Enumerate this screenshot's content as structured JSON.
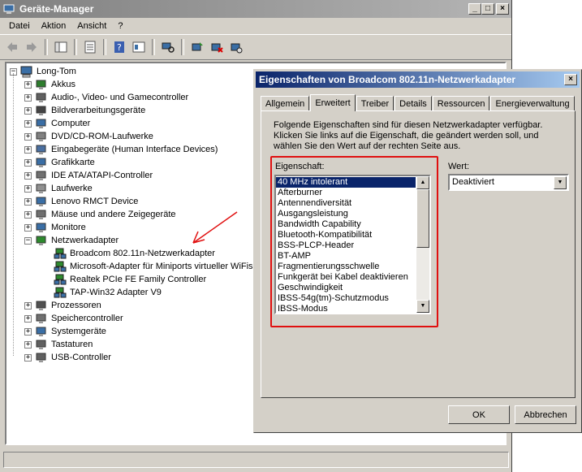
{
  "main_window": {
    "title": "Geräte-Manager",
    "controls": {
      "minimize": "_",
      "maximize": "□",
      "close": "×"
    },
    "menu": [
      "Datei",
      "Aktion",
      "Ansicht",
      "?"
    ]
  },
  "tree": {
    "root": "Long-Tom",
    "categories": [
      {
        "label": "Akkus",
        "icon": "battery-icon",
        "color": "#2d7d2d"
      },
      {
        "label": "Audio-, Video- und Gamecontroller",
        "icon": "speaker-icon",
        "color": "#606060"
      },
      {
        "label": "Bildverarbeitungsgeräte",
        "icon": "camera-icon",
        "color": "#444444"
      },
      {
        "label": "Computer",
        "icon": "computer-icon",
        "color": "#3a6ea5"
      },
      {
        "label": "DVD/CD-ROM-Laufwerke",
        "icon": "cdrom-icon",
        "color": "#808080"
      },
      {
        "label": "Eingabegeräte (Human Interface Devices)",
        "icon": "hid-icon",
        "color": "#4a6fa0"
      },
      {
        "label": "Grafikkarte",
        "icon": "display-adapter-icon",
        "color": "#3a6ea5"
      },
      {
        "label": "IDE ATA/ATAPI-Controller",
        "icon": "ide-icon",
        "color": "#707070"
      },
      {
        "label": "Laufwerke",
        "icon": "disk-drive-icon",
        "color": "#909090"
      },
      {
        "label": "Lenovo RMCT Device",
        "icon": "device-icon",
        "color": "#3a6ea5"
      },
      {
        "label": "Mäuse und andere Zeigegeräte",
        "icon": "mouse-icon",
        "color": "#707070"
      },
      {
        "label": "Monitore",
        "icon": "monitor-icon",
        "color": "#3a6ea5"
      },
      {
        "label": "Netzwerkadapter",
        "icon": "network-icon",
        "color": "#2d8a2d",
        "expanded": true,
        "children": [
          "Broadcom 802.11n-Netzwerkadapter",
          "Microsoft-Adapter für Miniports virtueller WiFis",
          "Realtek PCIe FE Family Controller",
          "TAP-Win32 Adapter V9"
        ]
      },
      {
        "label": "Prozessoren",
        "icon": "processor-icon",
        "color": "#505050"
      },
      {
        "label": "Speichercontroller",
        "icon": "storage-controller-icon",
        "color": "#707070"
      },
      {
        "label": "Systemgeräte",
        "icon": "system-device-icon",
        "color": "#3a6ea5"
      },
      {
        "label": "Tastaturen",
        "icon": "keyboard-icon",
        "color": "#606060"
      },
      {
        "label": "USB-Controller",
        "icon": "usb-icon",
        "color": "#606060"
      }
    ]
  },
  "dialog": {
    "title": "Eigenschaften von Broadcom 802.11n-Netzwerkadapter",
    "close": "×",
    "tabs": [
      {
        "label": "Allgemein",
        "selected": false
      },
      {
        "label": "Erweitert",
        "selected": true
      },
      {
        "label": "Treiber",
        "selected": false
      },
      {
        "label": "Details",
        "selected": false
      },
      {
        "label": "Ressourcen",
        "selected": false
      },
      {
        "label": "Energieverwaltung",
        "selected": false
      }
    ],
    "description": [
      "Folgende Eigenschaften sind für diesen Netzwerkadapter verfügbar.",
      "Klicken Sie links auf die Eigenschaft, die geändert werden soll, und",
      "wählen Sie den Wert auf der rechten Seite aus."
    ],
    "property_label": "Eigenschaft:",
    "properties": [
      "40 MHz intolerant",
      "Afterburner",
      "Antennendiversität",
      "Ausgangsleistung",
      "Bandwidth Capability",
      "Bluetooth-Kompatibilität",
      "BSS-PLCP-Header",
      "BT-AMP",
      "Fragmentierungsschwelle",
      "Funkgerät bei Kabel deaktivieren",
      "Geschwindigkeit",
      "IBSS-54g(tm)-Schutzmodus",
      "IBSS-Modus"
    ],
    "selected_property_index": 0,
    "value_label": "Wert:",
    "value": "Deaktiviert",
    "ok": "OK",
    "cancel": "Abbrechen"
  },
  "colors": {
    "highlight": "#0a246a",
    "annotation": "#e01010",
    "title_active": "#0a246a"
  }
}
